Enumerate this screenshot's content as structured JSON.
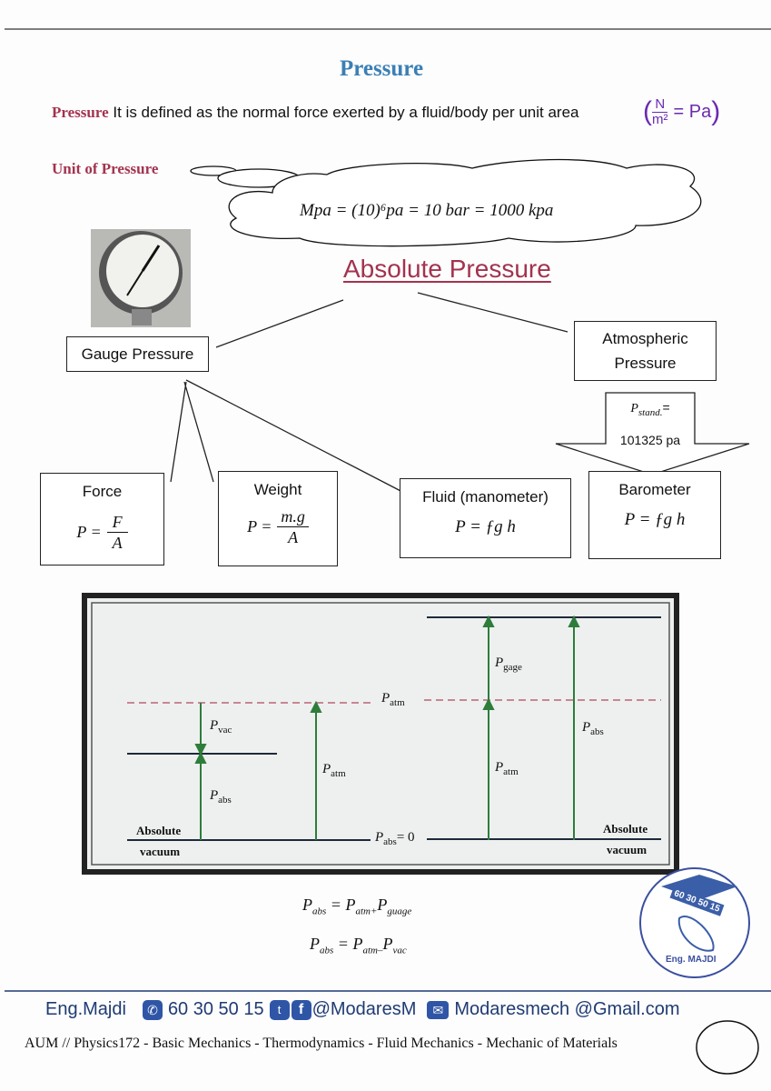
{
  "title": "Pressure",
  "definition": {
    "term": "Pressure",
    "text": "It is defined as the normal force exerted by a fluid/body per unit area",
    "handwritten_unit": {
      "numerator": "N",
      "denominator": "m²",
      "equals": "= Pa"
    }
  },
  "unit_heading": "Unit of Pressure",
  "unit_formula": "Mpa = (10)⁶pa = 10 bar = 1000 kpa",
  "main_heading": "Absolute Pressure",
  "gauge_box": "Gauge Pressure",
  "atmospheric_box": {
    "line1": "Atmospheric",
    "line2": "Pressure"
  },
  "standard_arrow": {
    "label": "P",
    "sub": "stand.",
    "eq": "=",
    "value": "101325 pa"
  },
  "sub_boxes": [
    {
      "title": "Force",
      "lhs": "P =",
      "num": "F",
      "den": "A"
    },
    {
      "title": "Weight",
      "lhs": "P =",
      "num": "m.g",
      "den": "A"
    },
    {
      "title": "Fluid (manometer)",
      "formula": "P = ƒg h"
    },
    {
      "title": "Barometer",
      "formula": "P = ƒg h"
    }
  ],
  "diagram": {
    "labels": {
      "p": "P",
      "atm": "atm",
      "vac": "vac",
      "abs": "abs",
      "gage": "gage",
      "zero": "= 0",
      "absolute": "Absolute",
      "vacuum": "vacuum"
    },
    "colors": {
      "arrow": "#2e7d3a",
      "dashed": "#b0485a",
      "level": "#1e2a3a"
    }
  },
  "equations": [
    {
      "lhs": "P",
      "lhs_sub": "abs",
      "eq": " = ",
      "a": "P",
      "a_sub": "atm",
      "op": "+",
      "b": "P",
      "b_sub": "guage"
    },
    {
      "lhs": "P",
      "lhs_sub": "abs",
      "eq": " = ",
      "a": "P",
      "a_sub": "atm",
      "op": "–",
      "b": "P",
      "b_sub": "vac"
    }
  ],
  "logo": {
    "phone": "60 30 50 15",
    "name": "Eng. MAJDI"
  },
  "footer": {
    "name": "Eng.Majdi",
    "phone": "60 30 50 15",
    "handle": "@ModaresM",
    "email": "Modaresmech @Gmail.com",
    "course": "AUM //  Physics172 - Basic Mechanics - Thermodynamics - Fluid Mechanics - Mechanic of Materials"
  },
  "colors": {
    "title": "#3a7fb5",
    "accent": "#a3334f",
    "footer": "#1f3b73",
    "handwriting": "#6a2bb0"
  }
}
